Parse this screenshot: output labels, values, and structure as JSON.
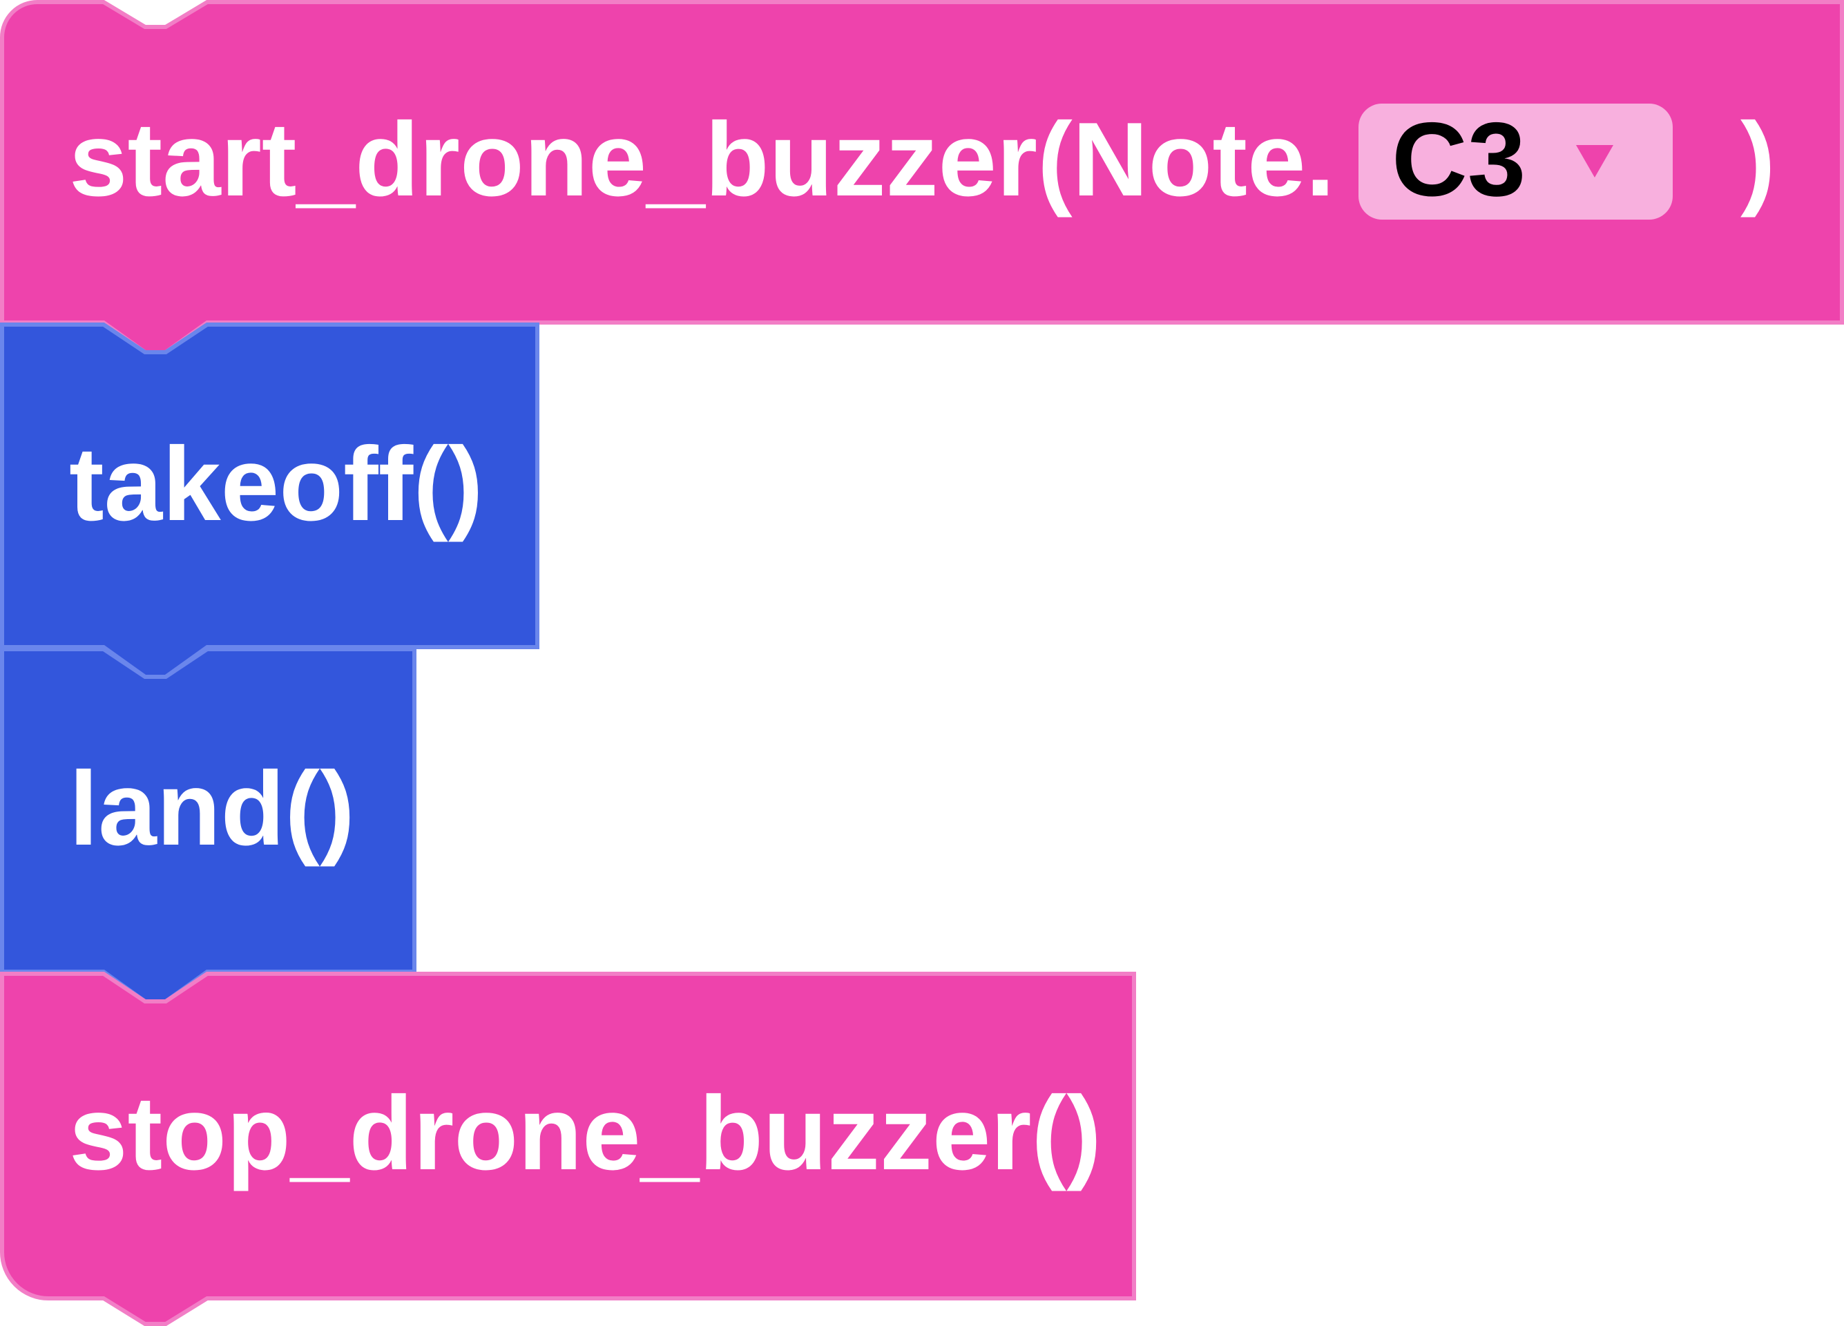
{
  "colors": {
    "buzzer_block_fill": "#ee43ac",
    "buzzer_block_border": "#f27ec6",
    "flight_block_fill": "#3356dc",
    "flight_block_border": "#6a86ec",
    "dropdown_fill": "#f8b0de",
    "dropdown_arrow": "#ee43ac",
    "text": "#ffffff",
    "dropdown_text": "#000000"
  },
  "blocks": {
    "start_buzzer": {
      "label": "start_drone_buzzer(Note.",
      "note_dropdown": {
        "value": "C3",
        "icon": "dropdown-arrow-icon"
      },
      "close_paren": ")"
    },
    "takeoff": {
      "label": "takeoff()"
    },
    "land": {
      "label": "land()"
    },
    "stop_buzzer": {
      "label": "stop_drone_buzzer()"
    }
  }
}
